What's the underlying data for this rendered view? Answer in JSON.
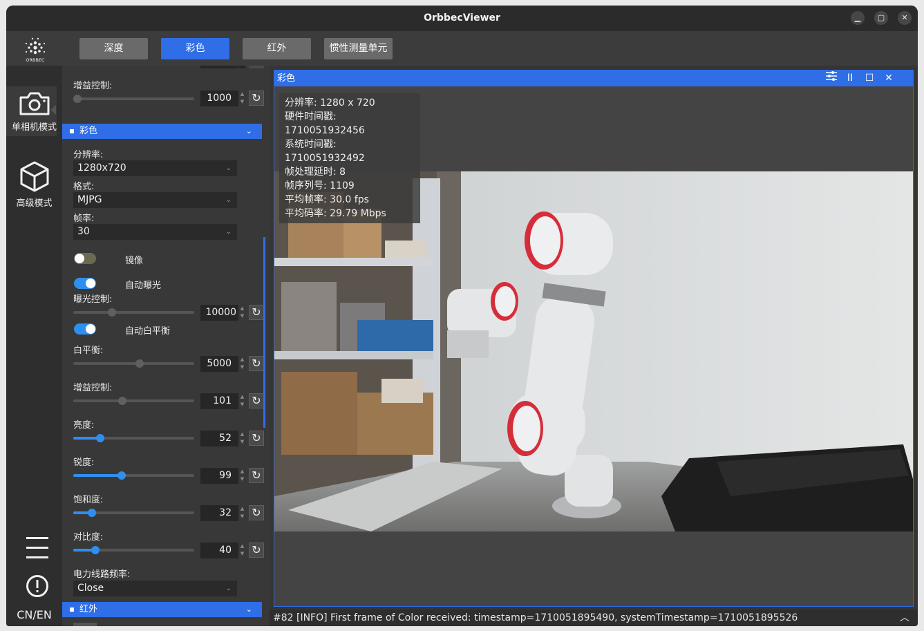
{
  "window": {
    "title": "OrbbecViewer"
  },
  "logo": {
    "text": "ORBBEC"
  },
  "tabs": [
    {
      "label": "深度",
      "active": false
    },
    {
      "label": "彩色",
      "active": true
    },
    {
      "label": "红外",
      "active": false
    },
    {
      "label": "惯性测量单元",
      "active": false
    }
  ],
  "nav": {
    "single_camera": "单相机模式",
    "advanced": "高级模式",
    "lang": "CN/EN"
  },
  "panel": {
    "gain_top": {
      "label": "增益控制:",
      "value": "1000"
    },
    "color_section": "彩色",
    "resolution": {
      "label": "分辨率:",
      "value": "1280x720"
    },
    "format": {
      "label": "格式:",
      "value": "MJPG"
    },
    "fps": {
      "label": "帧率:",
      "value": "30"
    },
    "mirror": {
      "label": "镜像",
      "on": false
    },
    "auto_exposure": {
      "label": "自动曝光",
      "on": true
    },
    "exposure": {
      "label": "曝光控制:",
      "value": "10000"
    },
    "auto_wb": {
      "label": "自动白平衡",
      "on": true
    },
    "white_balance": {
      "label": "白平衡:",
      "value": "5000"
    },
    "gain": {
      "label": "增益控制:",
      "value": "101"
    },
    "brightness": {
      "label": "亮度:",
      "value": "52"
    },
    "sharpness": {
      "label": "锐度:",
      "value": "99"
    },
    "saturation": {
      "label": "饱和度:",
      "value": "32"
    },
    "contrast": {
      "label": "对比度:",
      "value": "40"
    },
    "power_freq": {
      "label": "电力线路频率:",
      "value": "Close"
    },
    "ir_section": "红外"
  },
  "view": {
    "title": "彩色",
    "info": [
      "分辨率: 1280 x 720",
      "硬件时间戳: 1710051932456",
      "系统时间戳: 1710051932492",
      "帧处理延时: 8",
      "帧序列号: 1109",
      "平均帧率: 30.0 fps",
      "平均码率: 29.79 Mbps"
    ]
  },
  "status": {
    "text": "#82 [INFO] First frame of Color received: timestamp=1710051895490, systemTimestamp=1710051895526"
  },
  "colors": {
    "accent": "#2f6ee6",
    "slider": "#2f8ff0",
    "bg": "#353535"
  }
}
